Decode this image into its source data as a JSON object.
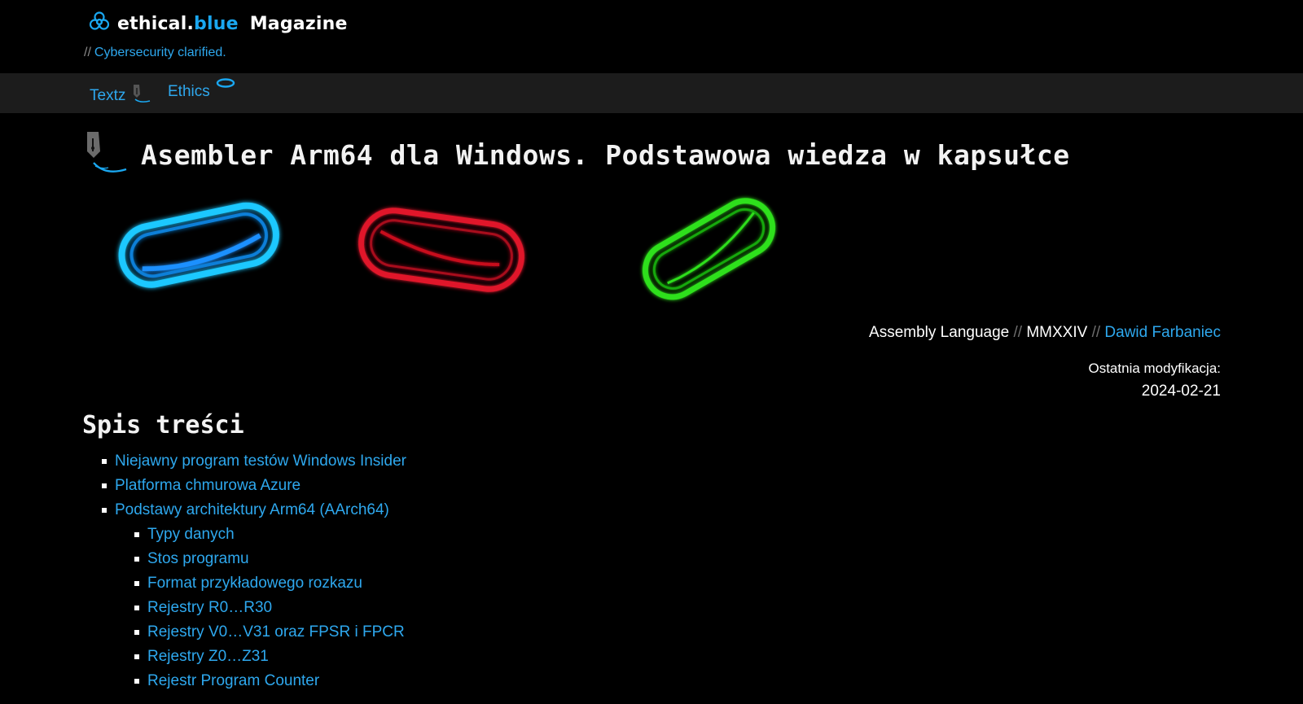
{
  "header": {
    "brand_ethical": "ethical",
    "brand_dot": ".",
    "brand_blue": "blue",
    "brand_magazine": "Magazine",
    "tagline_prefix": "//",
    "tagline": "Cybersecurity clarified."
  },
  "nav": {
    "items": [
      {
        "label": "Textz",
        "icon": "pen-nib-icon"
      },
      {
        "label": "Ethics",
        "icon": "halo-icon"
      }
    ]
  },
  "article": {
    "title": "Asembler Arm64 dla Windows. Podstawowa wiedza w kapsułce",
    "category": "Assembly Language",
    "separator": "//",
    "year": "MMXXIV",
    "author": "Dawid Farbaniec",
    "modified_label": "Ostatnia modyfikacja:",
    "modified_date": "2024-02-21"
  },
  "capsules": {
    "colors": [
      "#1ec8ff",
      "#e0192c",
      "#2ee01a"
    ]
  },
  "toc": {
    "heading": "Spis treści",
    "items": [
      {
        "label": "Niejawny program testów Windows Insider",
        "level": 1
      },
      {
        "label": "Platforma chmurowa Azure",
        "level": 1
      },
      {
        "label": "Podstawy architektury Arm64 (AArch64)",
        "level": 1
      },
      {
        "label": "Typy danych",
        "level": 2
      },
      {
        "label": "Stos programu",
        "level": 2
      },
      {
        "label": "Format przykładowego rozkazu",
        "level": 2
      },
      {
        "label": "Rejestry R0…R30",
        "level": 2
      },
      {
        "label": "Rejestry V0…V31 oraz FPSR i FPCR",
        "level": 2
      },
      {
        "label": "Rejestry Z0…Z31",
        "level": 2
      },
      {
        "label": "Rejestr Program Counter",
        "level": 2
      }
    ]
  },
  "colors": {
    "accent": "#2ea8ee",
    "background": "#000000",
    "navbar": "#1c1c1c"
  }
}
